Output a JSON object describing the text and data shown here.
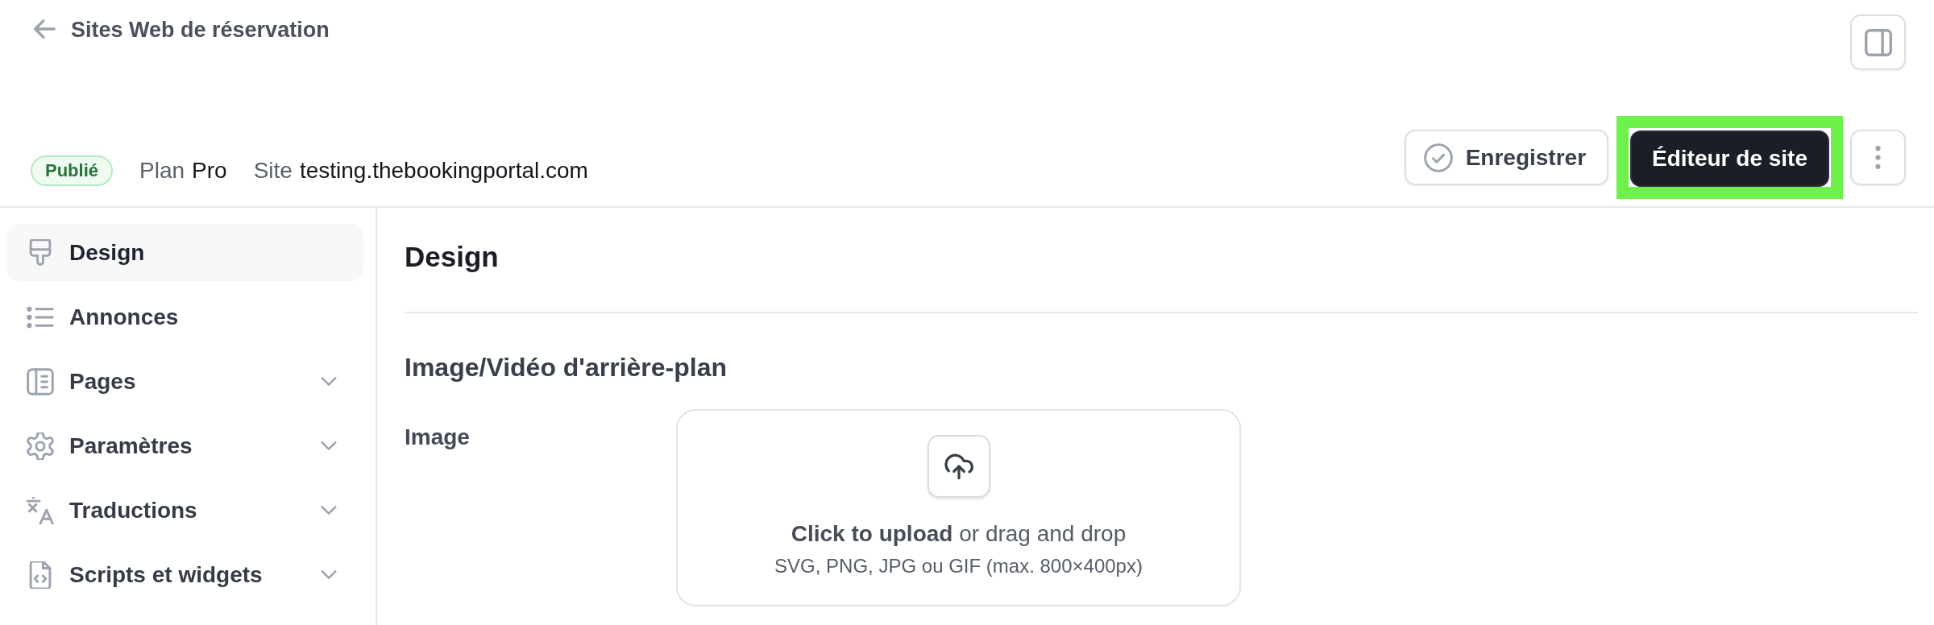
{
  "header": {
    "title": "Sites Web de réservation"
  },
  "site_bar": {
    "status": "Publié",
    "plan_label": "Plan",
    "plan": "Pro",
    "site_label": "Site",
    "site": "testing.thebookingportal.com"
  },
  "actions": [
    {
      "kind": "outline",
      "label": "Enregistrer",
      "highlighted": false
    },
    {
      "kind": "dark",
      "label": "Éditeur de site",
      "highlighted": true
    },
    {
      "kind": "menu",
      "highlighted": false
    }
  ],
  "sidebar": {
    "items": [
      {
        "label": "Design",
        "kind": "link",
        "selected": true
      },
      {
        "label": "Annonces",
        "kind": "link",
        "selected": false
      },
      {
        "label": "Pages",
        "kind": "group",
        "selected": false
      },
      {
        "label": "Paramètres",
        "kind": "group",
        "selected": false
      },
      {
        "label": "Traductions",
        "kind": "group",
        "selected": false
      },
      {
        "label": "Scripts et widgets",
        "kind": "group",
        "selected": false
      }
    ]
  },
  "content": {
    "title": "Design",
    "sections": [
      {
        "title": "Image/Vidéo d'arrière-plan",
        "fields": [
          {
            "label": "Image",
            "kind": "upload",
            "prompt": "**Click to upload** or drag and drop",
            "hint": "SVG, PNG, JPG ou GIF (max. 800×400px)"
          }
        ]
      }
    ]
  }
}
